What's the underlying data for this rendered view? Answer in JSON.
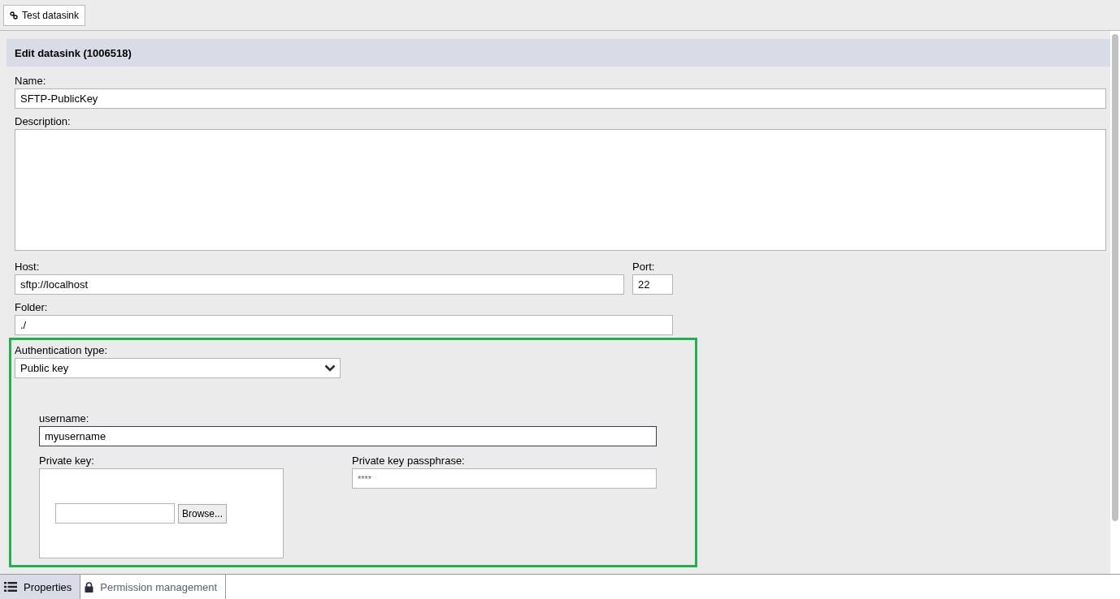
{
  "toolbar": {
    "buttons": [
      {
        "label": "Test datasink"
      }
    ]
  },
  "panel": {
    "title": "Edit datasink (1006518)"
  },
  "name": {
    "label": "Name:",
    "value": "SFTP-PublicKey"
  },
  "description": {
    "label": "Description:"
  },
  "host": {
    "label": "Host:",
    "value": "sftp://localhost"
  },
  "port": {
    "label": "Port:",
    "value": "22"
  },
  "folder": {
    "label": "Folder:",
    "value": "./"
  },
  "auth": {
    "label": "Authentication type:",
    "value": "Public key"
  },
  "username": {
    "label": "username:",
    "value": "myusername"
  },
  "private_key": {
    "label": "Private key:",
    "button": "Browse..."
  },
  "passphrase": {
    "label": "Private key passphrase:",
    "value": "****"
  },
  "tabs": [
    {
      "label": "Properties",
      "selected": true
    },
    {
      "label": "Permission management",
      "selected": false
    }
  ]
}
